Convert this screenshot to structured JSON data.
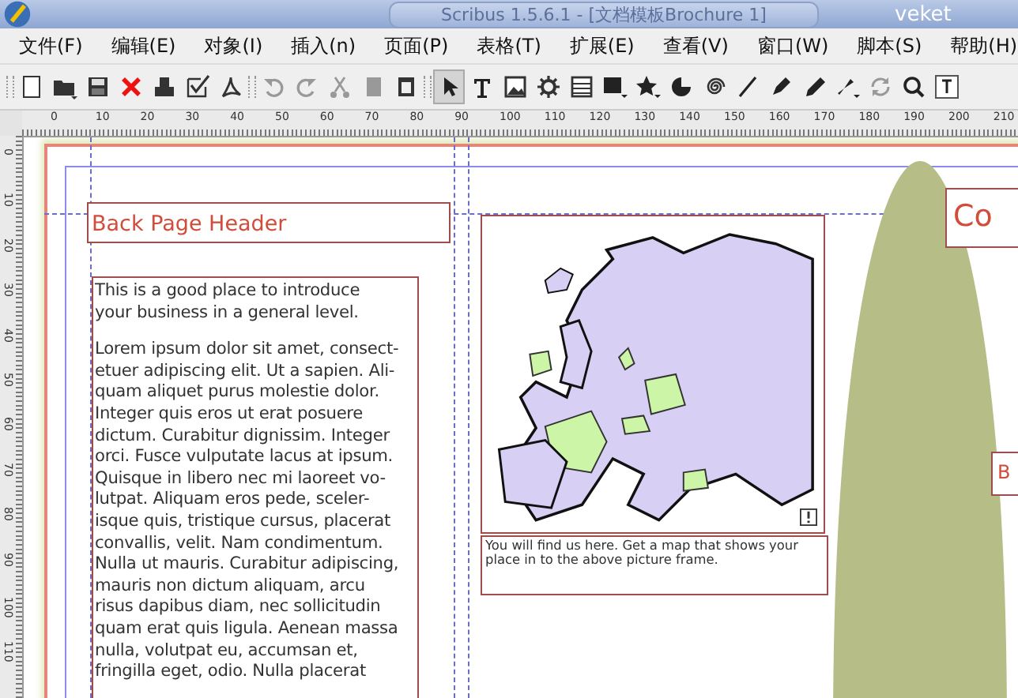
{
  "window": {
    "title": "Scribus  1.5.6.1 - [文档模板Brochure  1]",
    "user": "veket"
  },
  "menu": [
    "文件(F)",
    "编辑(E)",
    "对象(I)",
    "插入(n)",
    "页面(P)",
    "表格(T)",
    "扩展(E)",
    "查看(V)",
    "窗口(W)",
    "脚本(S)",
    "帮助(H)"
  ],
  "toolbar": {
    "actions": [
      {
        "kind": "grip"
      },
      {
        "kind": "new"
      },
      {
        "kind": "open"
      },
      {
        "kind": "save"
      },
      {
        "kind": "close"
      },
      {
        "kind": "print"
      },
      {
        "kind": "check"
      },
      {
        "kind": "pdf"
      },
      {
        "kind": "grip"
      },
      {
        "kind": "undo"
      },
      {
        "kind": "redo"
      },
      {
        "kind": "cut"
      },
      {
        "kind": "copy"
      },
      {
        "kind": "paste"
      },
      {
        "kind": "grip"
      }
    ],
    "tools": [
      {
        "kind": "select",
        "selected": true
      },
      {
        "kind": "text",
        "selected": false
      },
      {
        "kind": "image",
        "selected": false
      },
      {
        "kind": "gear",
        "selected": false
      },
      {
        "kind": "table",
        "selected": false
      },
      {
        "kind": "shape",
        "selected": false
      },
      {
        "kind": "star",
        "selected": false
      },
      {
        "kind": "arc",
        "selected": false
      },
      {
        "kind": "spiral",
        "selected": false
      },
      {
        "kind": "line",
        "selected": false
      },
      {
        "kind": "bezier",
        "selected": false
      },
      {
        "kind": "pencil",
        "selected": false
      },
      {
        "kind": "brush",
        "selected": false
      },
      {
        "kind": "rotate",
        "selected": false
      },
      {
        "kind": "zoom",
        "selected": false
      },
      {
        "kind": "textbox",
        "selected": false
      }
    ]
  },
  "ruler": {
    "horizontal": [
      "0",
      "10",
      "20",
      "30",
      "40",
      "50",
      "60",
      "70",
      "80",
      "90",
      "100",
      "110",
      "120",
      "130",
      "140",
      "150",
      "160",
      "170",
      "180",
      "190",
      "200",
      "210"
    ],
    "vertical": [
      "0",
      "10",
      "20",
      "30",
      "40",
      "50",
      "60",
      "70",
      "80",
      "90",
      "100",
      "110"
    ]
  },
  "page": {
    "header": "Back Page Header",
    "intro": "This is a good place to introduce\nyour business in a general level.",
    "body": "Lorem ipsum dolor sit amet, consect-\netuer adipiscing elit. Ut a sapien. Ali-\nquam aliquet purus molestie dolor.\nInteger quis eros ut erat posuere\ndictum. Curabitur dignissim. Integer\norci. Fusce vulputate lacus at ipsum.\nQuisque in libero nec mi laoreet vo-\nlutpat. Aliquam eros pede, sceler-\nisque quis, tristique cursus, placerat\nconvallis, velit. Nam condimentum.\nNulla ut mauris. Curabitur adipiscing,\nmauris non dictum aliquam, arcu\nrisus dapibus diam, nec sollicitudin\nquam erat quis ligula. Aenean massa\nnulla, volutpat eu, accumsan et,\nfringilla eget, odio. Nulla placerat",
    "caption": "You will find us here. Get a map that shows your\nplace in to the above picture frame.",
    "right_header": "Co",
    "right_label": "B"
  }
}
